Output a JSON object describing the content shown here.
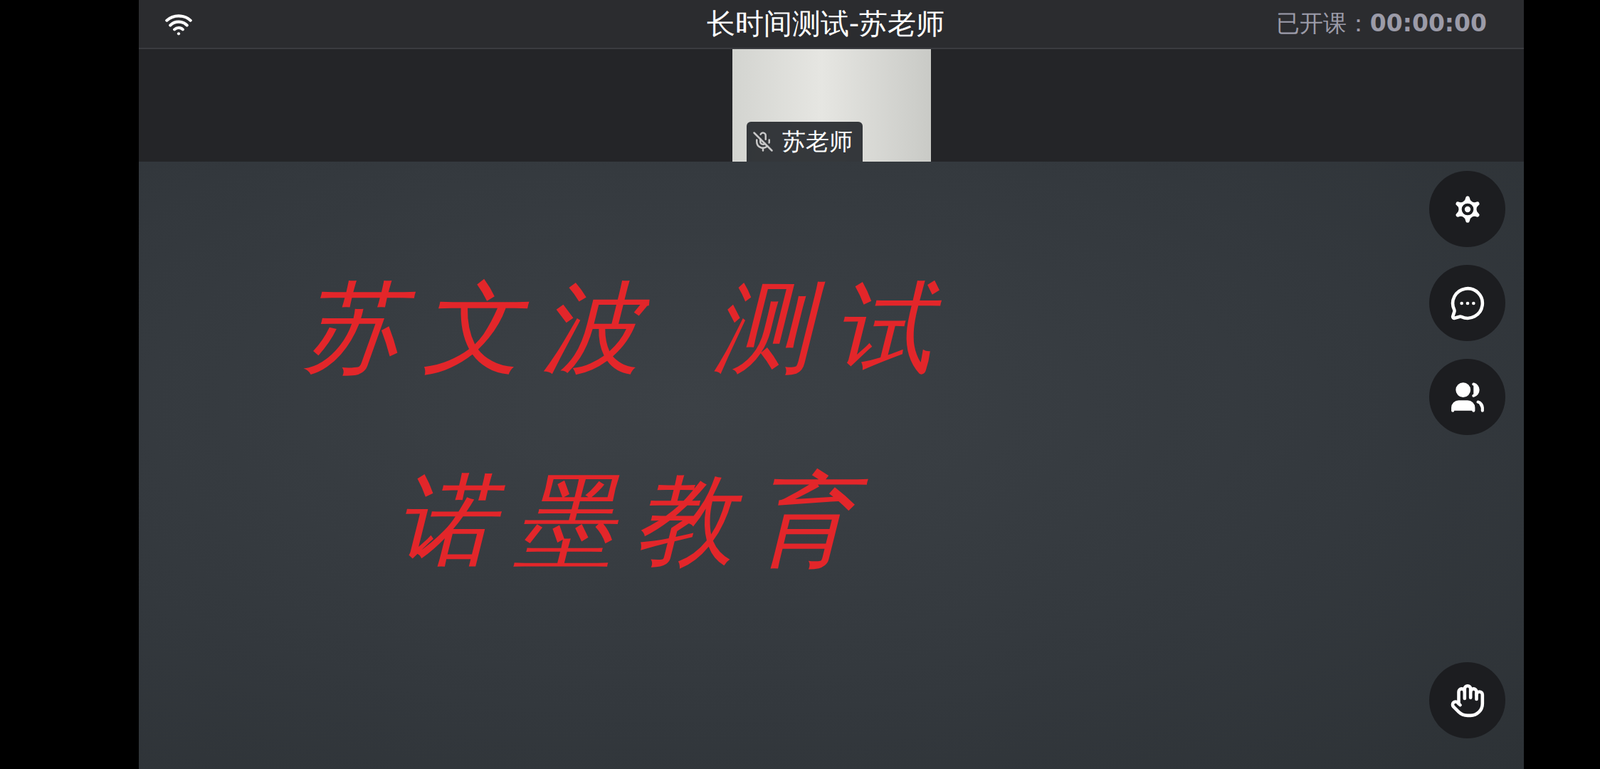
{
  "window": {
    "title": "长时间测试-苏老师"
  },
  "class_timer": {
    "label": "已开课：",
    "time": "00:00:00"
  },
  "video": {
    "name": "苏老师",
    "muted": true
  },
  "board": {
    "lines": [
      "苏文波 测试",
      "诺墨教育"
    ]
  }
}
